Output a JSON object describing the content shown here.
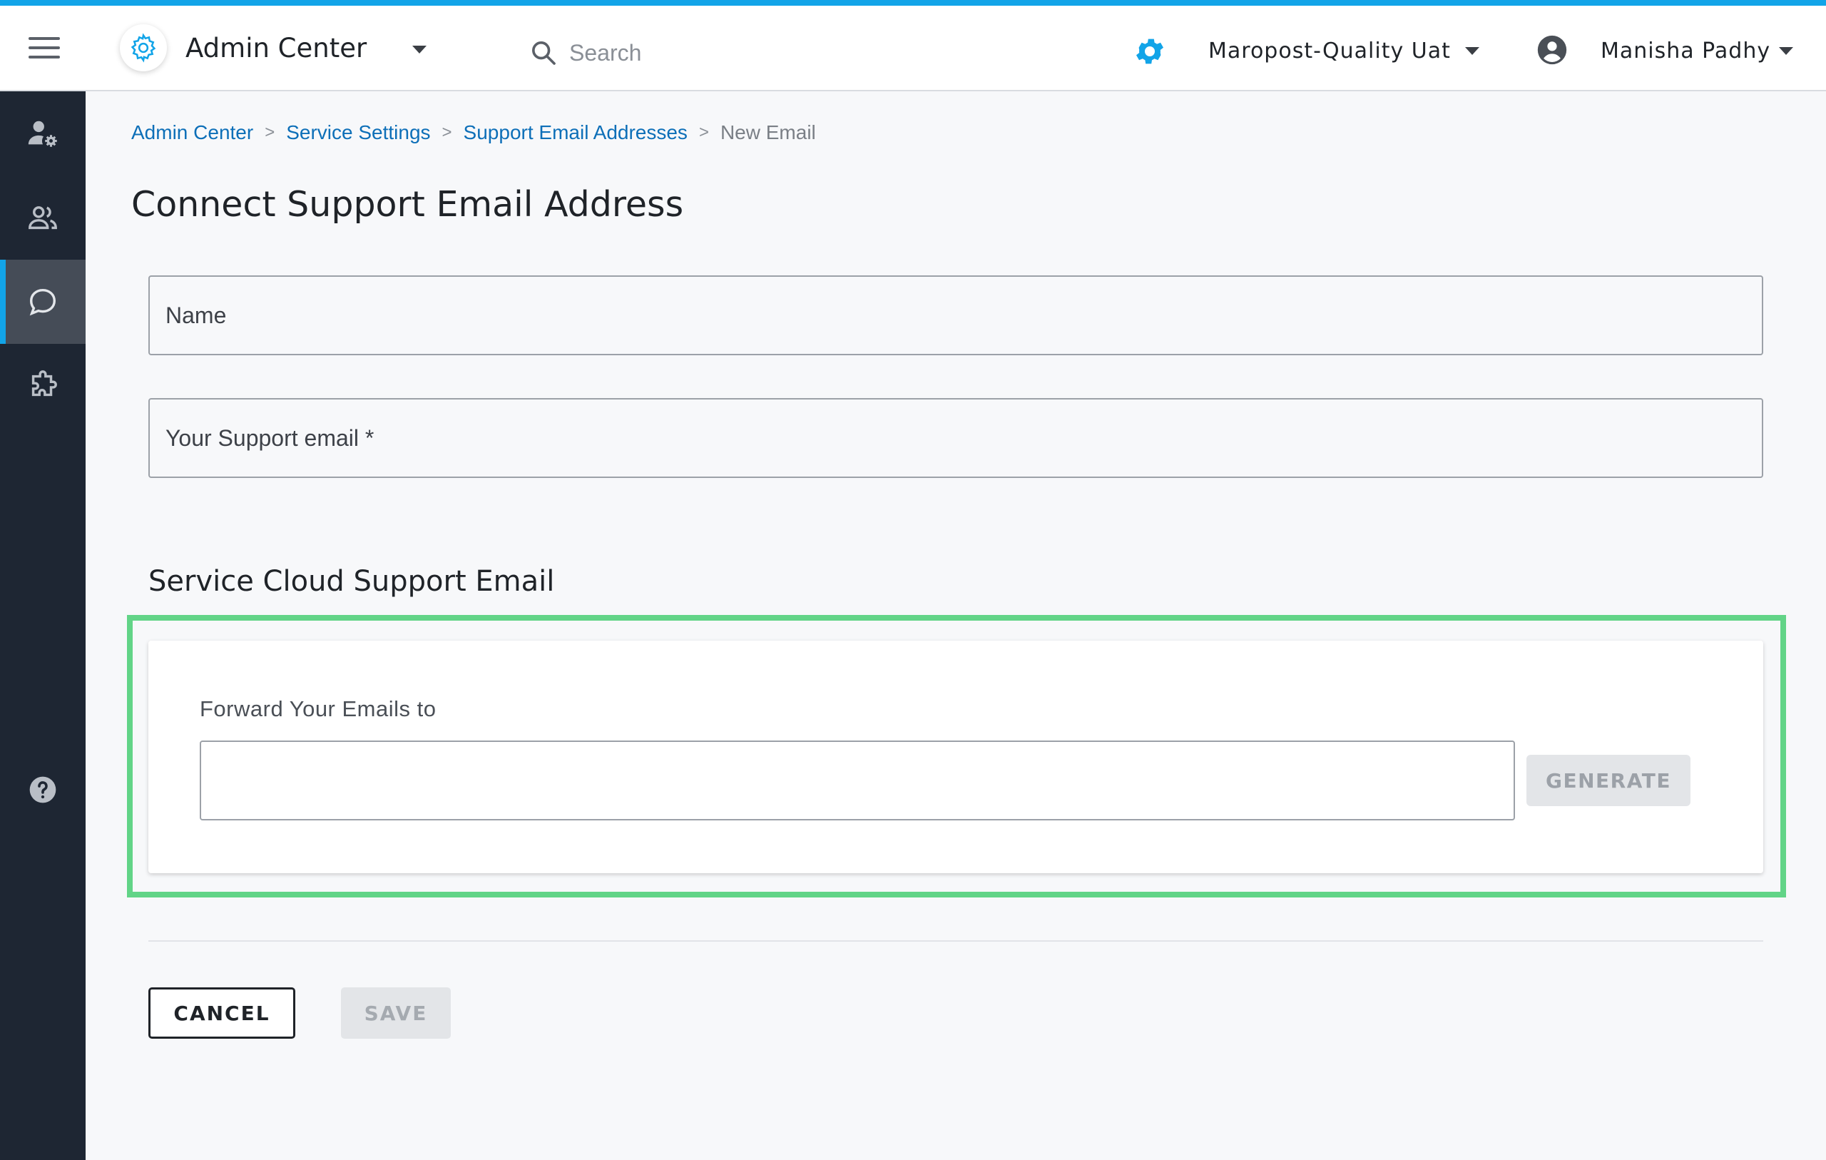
{
  "header": {
    "app_title": "Admin Center",
    "search_placeholder": "Search",
    "tenant_name": "Maropost-Quality Uat",
    "user_name": "Manisha Padhy",
    "accent_color": "#12a4e8"
  },
  "sidebar": {
    "items": [
      {
        "icon": "user-settings-icon",
        "active": false
      },
      {
        "icon": "users-icon",
        "active": false
      },
      {
        "icon": "chat-bubble-icon",
        "active": true
      },
      {
        "icon": "puzzle-icon",
        "active": false
      },
      {
        "icon": "help-icon",
        "active": false
      }
    ]
  },
  "breadcrumb": {
    "items": [
      "Admin Center",
      "Service Settings",
      "Support Email Addresses"
    ],
    "current": "New Email",
    "separator": ">"
  },
  "page": {
    "title": "Connect Support Email Address",
    "name_placeholder": "Name",
    "support_email_placeholder": "Your Support email *",
    "section_title": "Service Cloud Support Email",
    "forward_label": "Forward Your Emails to",
    "forward_value": "",
    "generate_label": "GENERATE",
    "cancel_label": "CANCEL",
    "save_label": "SAVE",
    "highlight_color": "#62d487"
  }
}
